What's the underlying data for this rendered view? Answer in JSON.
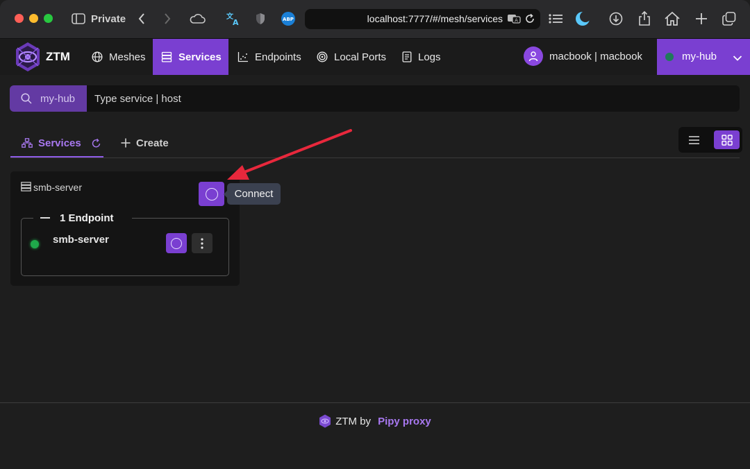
{
  "browser": {
    "private_label": "Private",
    "url": "localhost:7777/#/mesh/services",
    "abp_label": "ABP"
  },
  "app": {
    "logo_text": "ZTM",
    "nav": [
      {
        "label": "Meshes",
        "icon": "globe-icon"
      },
      {
        "label": "Services",
        "icon": "server-icon",
        "active": true
      },
      {
        "label": "Endpoints",
        "icon": "scatter-icon"
      },
      {
        "label": "Local Ports",
        "icon": "target-icon"
      },
      {
        "label": "Logs",
        "icon": "document-icon"
      }
    ],
    "user_label": "macbook | macbook",
    "hub_label": "my-hub",
    "hub_status_color": "#1f7a5a",
    "accent_color": "#7a3fd1"
  },
  "search": {
    "prefix_label": "my-hub",
    "placeholder": "Type service | host"
  },
  "tabs": {
    "services_label": "Services",
    "create_label": "Create"
  },
  "card": {
    "title": "smb-server",
    "connect_tooltip": "Connect",
    "endpoints_legend": "1 Endpoint",
    "endpoint_name": "smb-server",
    "endpoint_status_color": "#1fa84a"
  },
  "footer": {
    "prefix": "ZTM by",
    "brand": "Pipy proxy"
  }
}
